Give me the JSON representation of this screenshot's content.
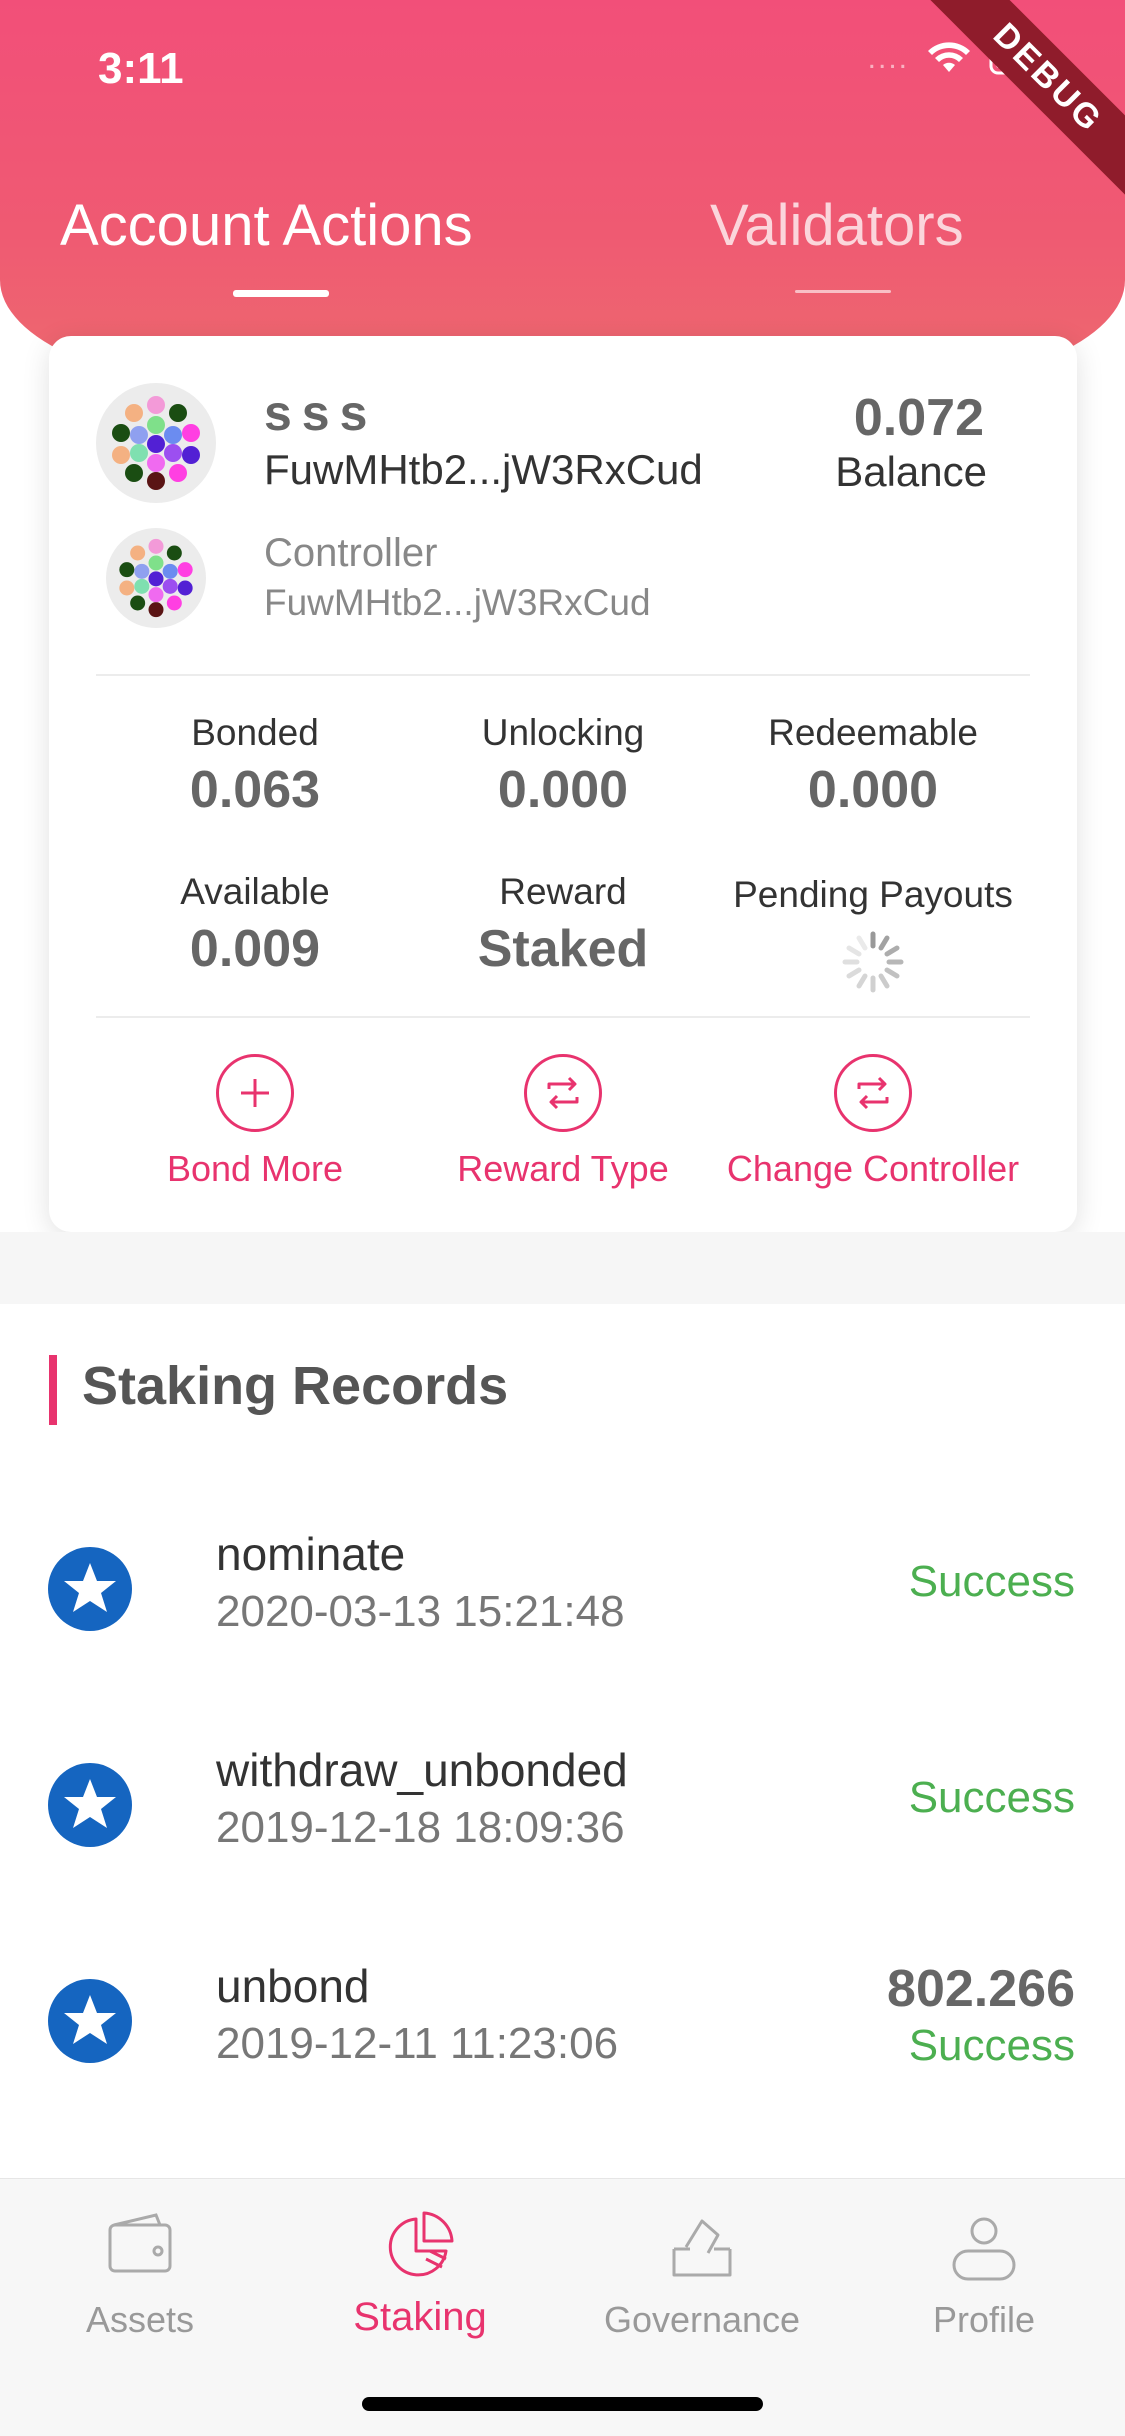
{
  "status_bar": {
    "time": "3:11",
    "signal": "....",
    "debug_label": "DEBUG"
  },
  "tabs": [
    {
      "label": "Account Actions",
      "active": true
    },
    {
      "label": "Validators",
      "active": false
    }
  ],
  "account": {
    "name": "sss",
    "address": "FuwMHtb2...jW3RxCud",
    "balance_value": "0.072",
    "balance_label": "Balance",
    "controller_label": "Controller",
    "controller_address": "FuwMHtb2...jW3RxCud"
  },
  "stats": {
    "bonded": {
      "label": "Bonded",
      "value": "0.063"
    },
    "unlocking": {
      "label": "Unlocking",
      "value": "0.000"
    },
    "redeemable": {
      "label": "Redeemable",
      "value": "0.000"
    },
    "available": {
      "label": "Available",
      "value": "0.009"
    },
    "reward": {
      "label": "Reward",
      "value": "Staked"
    },
    "pending": {
      "label": "Pending Payouts"
    }
  },
  "actions": {
    "bond_more": "Bond More",
    "reward_type": "Reward Type",
    "change_controller": "Change Controller"
  },
  "records": {
    "title": "Staking Records",
    "items": [
      {
        "name": "nominate",
        "time": "2020-03-13 15:21:48",
        "status": "Success",
        "amount": ""
      },
      {
        "name": "withdraw_unbonded",
        "time": "2019-12-18 18:09:36",
        "status": "Success",
        "amount": ""
      },
      {
        "name": "unbond",
        "time": "2019-12-11 11:23:06",
        "status": "Success",
        "amount": "802.266"
      }
    ]
  },
  "nav": {
    "assets": "Assets",
    "staking": "Staking",
    "governance": "Governance",
    "profile": "Profile"
  },
  "colors": {
    "accent": "#e8336e",
    "header": "#f24f79",
    "success": "#4caf50",
    "record_icon": "#1565c0"
  }
}
